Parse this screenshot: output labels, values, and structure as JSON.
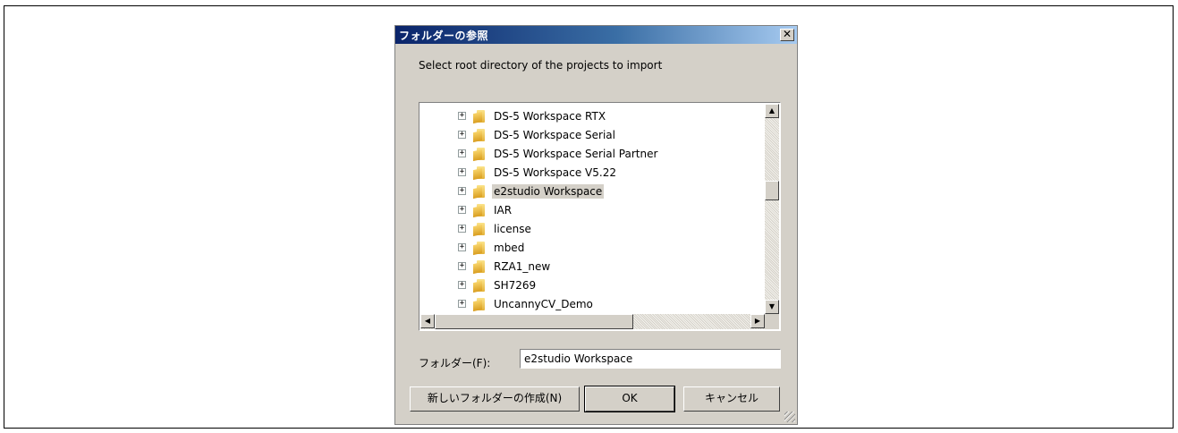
{
  "dialog": {
    "title": "フォルダーの参照",
    "close_glyph": "✕",
    "prompt": "Select root directory of the projects to import"
  },
  "tree": {
    "items": [
      {
        "label": "DS-5 Workspace RTX",
        "expander": "+"
      },
      {
        "label": "DS-5 Workspace Serial",
        "expander": "+"
      },
      {
        "label": "DS-5 Workspace Serial Partner",
        "expander": "+"
      },
      {
        "label": "DS-5 Workspace V5.22",
        "expander": "+"
      },
      {
        "label": "e2studio Workspace",
        "expander": "+",
        "selected": true
      },
      {
        "label": "IAR",
        "expander": "+"
      },
      {
        "label": "license",
        "expander": "+"
      },
      {
        "label": "mbed",
        "expander": "+"
      },
      {
        "label": "RZA1_new",
        "expander": "+"
      },
      {
        "label": "SH7269",
        "expander": "+"
      },
      {
        "label": "UncannyCV_Demo",
        "expander": "+"
      }
    ]
  },
  "scroll": {
    "up": "▲",
    "down": "▼",
    "left": "◀",
    "right": "▶"
  },
  "folder_field": {
    "label": "フォルダー(F):",
    "value": "e2studio Workspace"
  },
  "buttons": {
    "new_folder": "新しいフォルダーの作成(N)",
    "ok": "OK",
    "cancel": "キャンセル"
  },
  "colors": {
    "title_start": "#0a246a",
    "title_end": "#a6caf0",
    "dialog_bg": "#d4d0c8"
  }
}
